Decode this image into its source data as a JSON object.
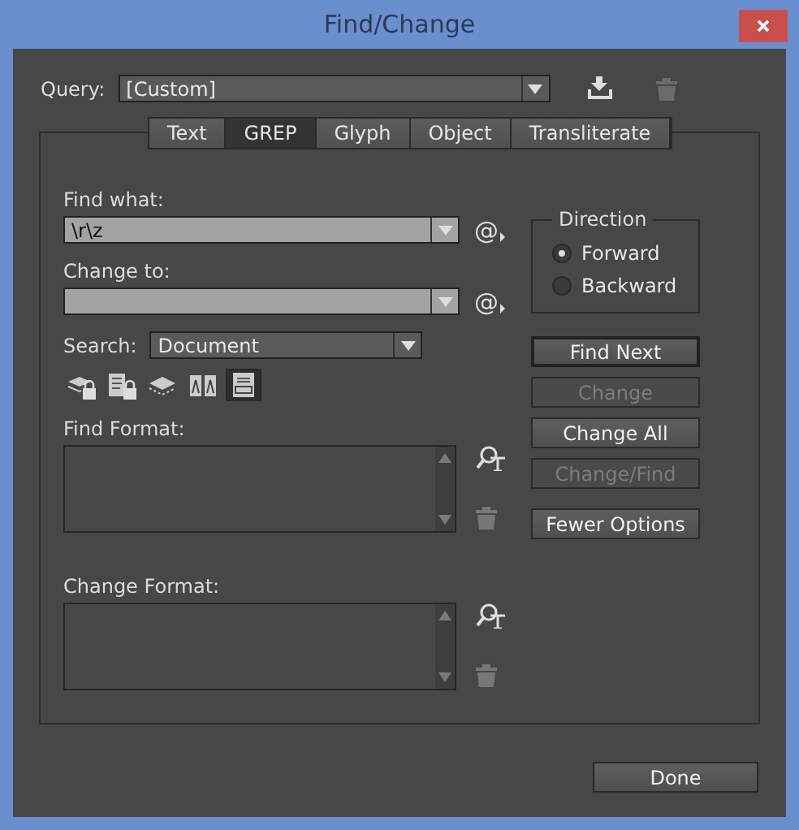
{
  "window": {
    "title": "Find/Change"
  },
  "query": {
    "label": "Query:",
    "value": "[Custom]"
  },
  "tabs": [
    {
      "label": "Text",
      "selected": false
    },
    {
      "label": "GREP",
      "selected": true
    },
    {
      "label": "Glyph",
      "selected": false
    },
    {
      "label": "Object",
      "selected": false
    },
    {
      "label": "Transliterate",
      "selected": false
    }
  ],
  "find_what": {
    "label": "Find what:",
    "value": "\\r\\z",
    "special_button": "@"
  },
  "change_to": {
    "label": "Change to:",
    "special_button": "@"
  },
  "search": {
    "label": "Search:",
    "value": "Document"
  },
  "options": [
    {
      "kind": "locked-layers",
      "selected": false
    },
    {
      "kind": "locked-stories",
      "selected": false
    },
    {
      "kind": "hidden-layers",
      "selected": false
    },
    {
      "kind": "master-pages",
      "selected": false
    },
    {
      "kind": "footnotes",
      "selected": true
    }
  ],
  "find_format": {
    "label": "Find Format:"
  },
  "change_format": {
    "label": "Change Format:"
  },
  "direction": {
    "title": "Direction",
    "options": [
      {
        "label": "Forward",
        "selected": true
      },
      {
        "label": "Backward",
        "selected": false
      }
    ]
  },
  "buttons": [
    {
      "label": "Find Next",
      "disabled": false,
      "focused": true
    },
    {
      "label": "Change",
      "disabled": true,
      "focused": false
    },
    {
      "label": "Change All",
      "disabled": false,
      "focused": false
    },
    {
      "label": "Change/Find",
      "disabled": true,
      "focused": false
    },
    {
      "label": "Fewer Options",
      "disabled": false,
      "focused": false
    }
  ],
  "done": {
    "label": "Done"
  }
}
